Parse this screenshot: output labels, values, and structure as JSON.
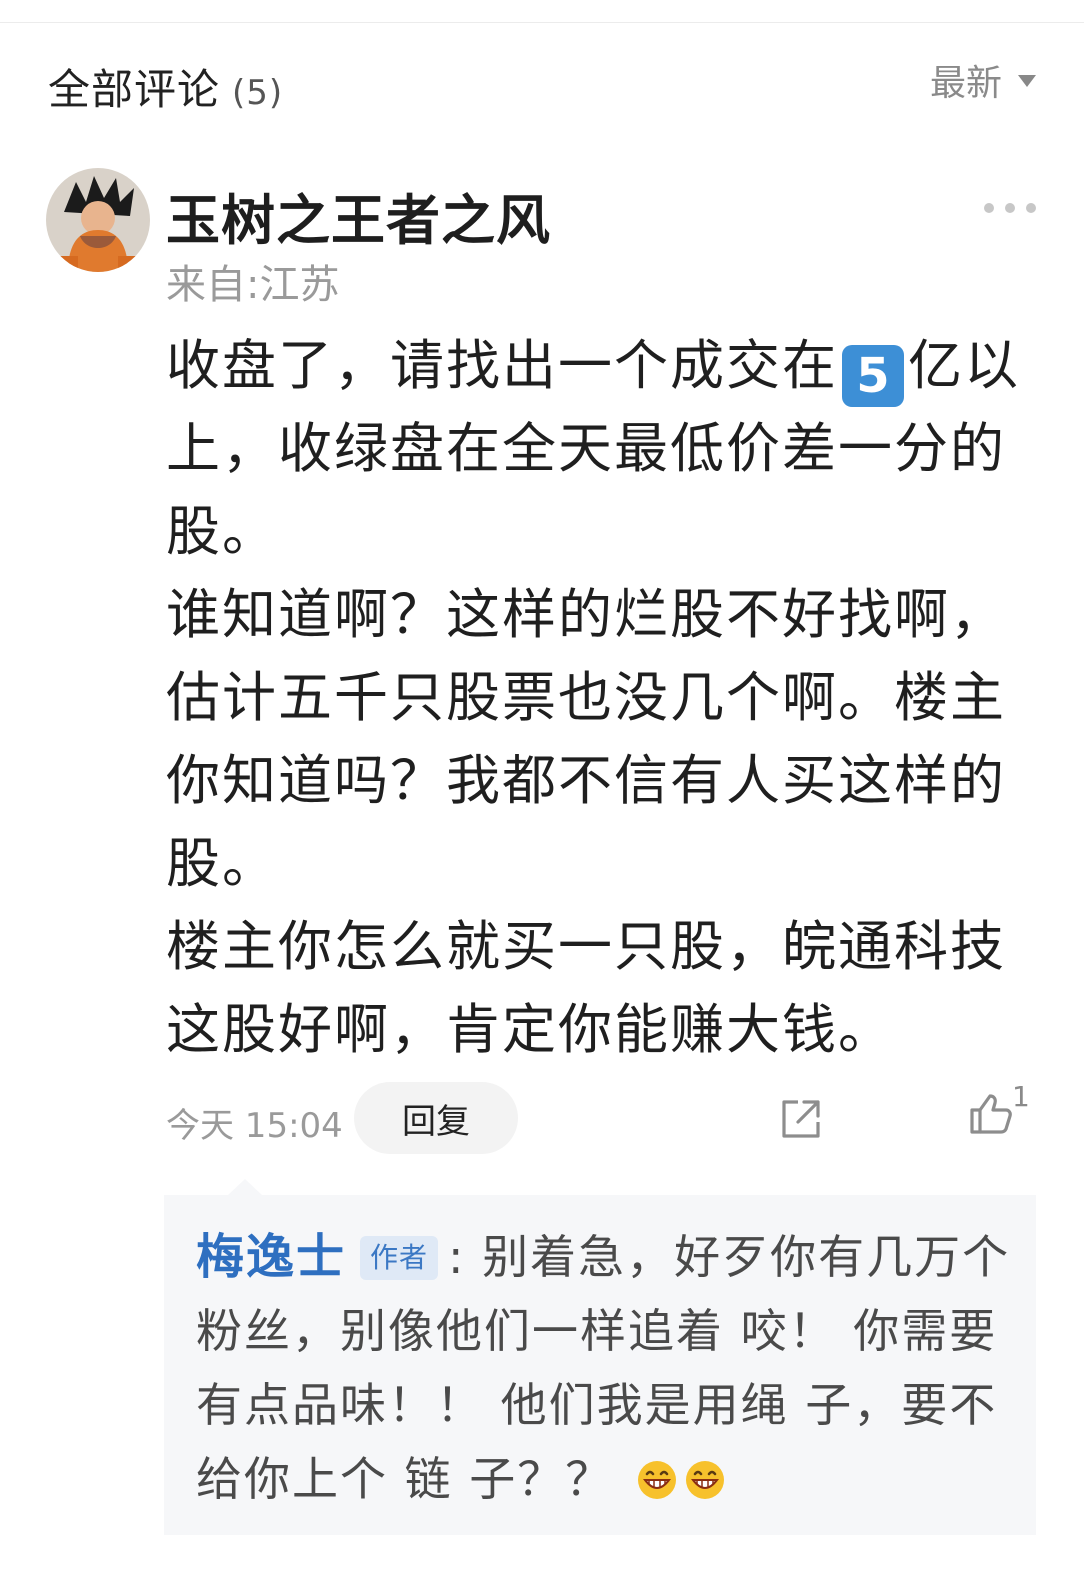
{
  "header": {
    "title": "全部评论",
    "count": "(5)",
    "sort_label": "最新"
  },
  "comment": {
    "username": "玉树之王者之风",
    "location": "来自:江苏",
    "body": {
      "line1_before": "收盘了，请找出一个成交在",
      "number_badge": "5",
      "line1_after": "亿以上，收绿盘在全天最低价差一分的股。",
      "para2": "谁知道啊？这样的烂股不好找啊，估计五千只股票也没几个啊。楼主你知道吗？我都不信有人买这样的股。",
      "para3": "楼主你怎么就买一只股，皖通科技这股好啊，肯定你能赚大钱。"
    },
    "timestamp": "今天 15:04",
    "reply_label": "回复",
    "like_count": "1"
  },
  "reply": {
    "author": "梅逸士",
    "badge": "作者",
    "text": ": 别着急，好歹你有几万个粉丝，别像他们一样追着 咬！ 你需要有点品味！！ 他们我是用绳 子，要不给你上个 链 子？？",
    "emojis": [
      "grinning-face-icon",
      "grinning-face-icon"
    ]
  },
  "colors": {
    "accent_blue": "#2e6fc0",
    "badge_blue": "#3d8fd6",
    "muted_text": "#9a9a9a",
    "reply_bg": "#f6f7f9"
  }
}
